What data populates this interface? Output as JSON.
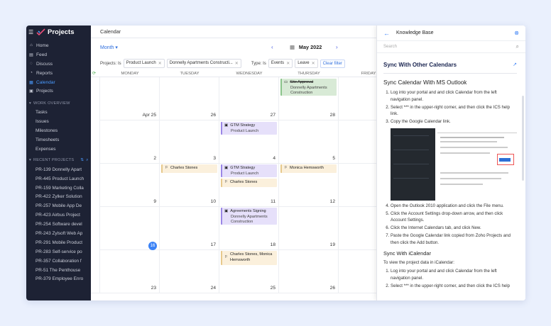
{
  "sidebar": {
    "app_title": "Projects",
    "nav": [
      {
        "label": "Home",
        "icon": "home-icon"
      },
      {
        "label": "Feed",
        "icon": "feed-icon"
      },
      {
        "label": "Discuss",
        "icon": "discuss-icon"
      },
      {
        "label": "Reports",
        "icon": "reports-icon"
      },
      {
        "label": "Calendar",
        "icon": "calendar-icon",
        "active": true
      },
      {
        "label": "Projects",
        "icon": "projects-icon"
      }
    ],
    "work_overview_label": "WORK OVERVIEW",
    "work_items": [
      "Tasks",
      "Issues",
      "Milestones",
      "Timesheets",
      "Expenses"
    ],
    "recent_label": "RECENT PROJECTS",
    "recent_projects": [
      "PR-139 Donnelly Apart",
      "PR-445 Product Launch",
      "PR-159 Marketing Colla",
      "PR-422 Zylker Solution",
      "PR-257 Mobile App De",
      "PR-423 Airbus Project",
      "PR-254 Software devel",
      "PR-243 Zylsoft Web Ap",
      "PR-291 Mobile Product",
      "PR-283 Self-service po",
      "PR-357 Collaboration f",
      "PR-51 The Penthouse",
      "PR-379 Employee Enro"
    ]
  },
  "topbar": {
    "title": "Calendar"
  },
  "controls": {
    "view": "Month",
    "prev": "‹",
    "next": "›",
    "current": "May 2022"
  },
  "filters": {
    "projects_label": "Projects: Is",
    "project_chips": [
      "Product Launch",
      "Donnelly Apartments Constructi..."
    ],
    "type_label": "Type: Is",
    "type_chips": [
      "Events",
      "Leave"
    ],
    "clear": "Clear filter"
  },
  "days": [
    "MONDAY",
    "TUESDAY",
    "WEDNESDAY",
    "THURSDAY",
    "FRIDAY"
  ],
  "weeks": [
    [
      "Apr 25",
      "26",
      "27",
      "28",
      ""
    ],
    [
      "2",
      "3",
      "4",
      "5",
      ""
    ],
    [
      "9",
      "10",
      "11",
      "12",
      ""
    ],
    [
      "16",
      "17",
      "18",
      "19",
      ""
    ],
    [
      "23",
      "24",
      "25",
      "26",
      ""
    ]
  ],
  "events": [
    {
      "title": "Site Approval",
      "sub": "Donnelly Apartments Construction",
      "icon": "milestone-icon"
    },
    {
      "title": "GTM Strategy",
      "sub": "Product Launch",
      "icon": "event-icon"
    },
    {
      "title": "Charles Stones",
      "sub": "",
      "icon": "leave-icon"
    },
    {
      "title": "GTM Strategy",
      "sub": "Product Launch",
      "icon": "event-icon"
    },
    {
      "title": "Charles Stones",
      "sub": "",
      "icon": "leave-icon"
    },
    {
      "title": "Monica Hemsworth",
      "sub": "",
      "icon": "leave-icon"
    },
    {
      "title": "Agreements Signing",
      "sub": "Donnelly Apartments Construction",
      "icon": "event-icon"
    },
    {
      "title": "Charles Stones, Monica Hemsworth",
      "sub": "",
      "icon": "leave-icon"
    }
  ],
  "panel": {
    "title": "Knowledge Base",
    "search_placeholder": "Search",
    "section": "Sync With Other Calendars",
    "heading": "Sync Calendar With MS Outlook",
    "steps1": [
      "Log into your portal and and click Calendar from the left navigation panel.",
      "Select *** in the upper-right corner, and then click the ICS help link.",
      "Copy the Google Calendar link."
    ],
    "steps2": [
      "Open the Outlook 2010 application and click the File menu.",
      "Click the Account Settings drop-down arrow, and then click Account Settings.",
      "Click the Internet Calendars tab, and click New.",
      "Paste the Google Calendar link copied from Zoho Projects and then click the Add button."
    ],
    "heading2": "Sync With iCalendar",
    "intro2": "To view the project data in iCalendar:",
    "steps3": [
      "Log into your portal and and click Calendar from the left navigation panel.",
      "Select *** in the upper-right corner, and then click the ICS help"
    ]
  }
}
